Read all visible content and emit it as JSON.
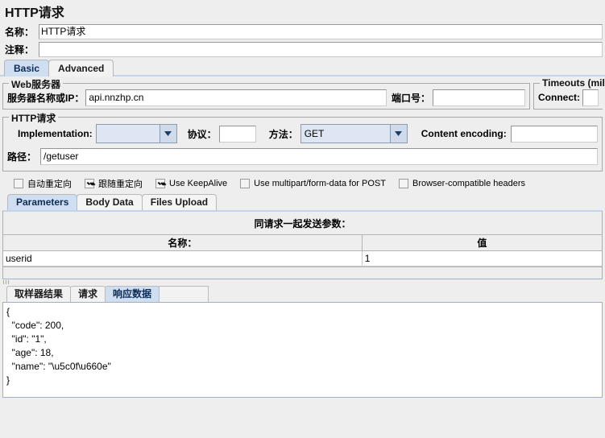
{
  "header": {
    "title": "HTTP请求"
  },
  "fields": {
    "name_label": "名称：",
    "name_value": "HTTP请求",
    "comment_label": "注释：",
    "comment_value": ""
  },
  "main_tabs": [
    {
      "label": "Basic",
      "selected": true
    },
    {
      "label": "Advanced",
      "selected": false
    }
  ],
  "web_server": {
    "group_title": "Web服务器",
    "server_label": "服务器名称或IP：",
    "server_value": "api.nnzhp.cn",
    "port_label": "端口号：",
    "port_value": ""
  },
  "timeouts": {
    "group_title": "Timeouts (milli",
    "connect_label": "Connect:",
    "connect_value": ""
  },
  "http_request": {
    "group_title": "HTTP请求",
    "implementation_label": "Implementation:",
    "implementation_value": "",
    "protocol_label": "协议：",
    "protocol_value": "",
    "method_label": "方法：",
    "method_value": "GET",
    "content_encoding_label": "Content encoding:",
    "content_encoding_value": "",
    "path_label": "路径：",
    "path_value": "/getuser"
  },
  "checkboxes": [
    {
      "label": "自动重定向",
      "checked": false
    },
    {
      "label": "跟随重定向",
      "checked": true
    },
    {
      "label": "Use KeepAlive",
      "checked": true
    },
    {
      "label": "Use multipart/form-data for POST",
      "checked": false
    },
    {
      "label": "Browser-compatible headers",
      "checked": false
    }
  ],
  "param_tabs": [
    {
      "label": "Parameters",
      "selected": true
    },
    {
      "label": "Body Data",
      "selected": false
    },
    {
      "label": "Files Upload",
      "selected": false
    }
  ],
  "parameters": {
    "caption": "同请求一起发送参数：",
    "columns": [
      "名称：",
      "值"
    ],
    "rows": [
      {
        "name": "userid",
        "value": "1"
      }
    ]
  },
  "result_tabs": [
    {
      "label": "取样器结果",
      "selected": false
    },
    {
      "label": "请求",
      "selected": false
    },
    {
      "label": "响应数据",
      "selected": true
    }
  ],
  "response": {
    "lines": [
      "{",
      "  \"code\": 200,",
      "  \"id\": \"1\",",
      "  \"age\": 18,",
      "  \"name\": \"\\u5c0f\\u660e\"",
      "}"
    ]
  },
  "icons": {
    "dropdown": "chevron-down-icon"
  },
  "colors": {
    "panel_bg": "#eeeeee",
    "selected_tab": "#cfdff1",
    "field_bg": "#ffffff",
    "combo_bg": "#dde6f2",
    "border": "#a8a8a8"
  }
}
